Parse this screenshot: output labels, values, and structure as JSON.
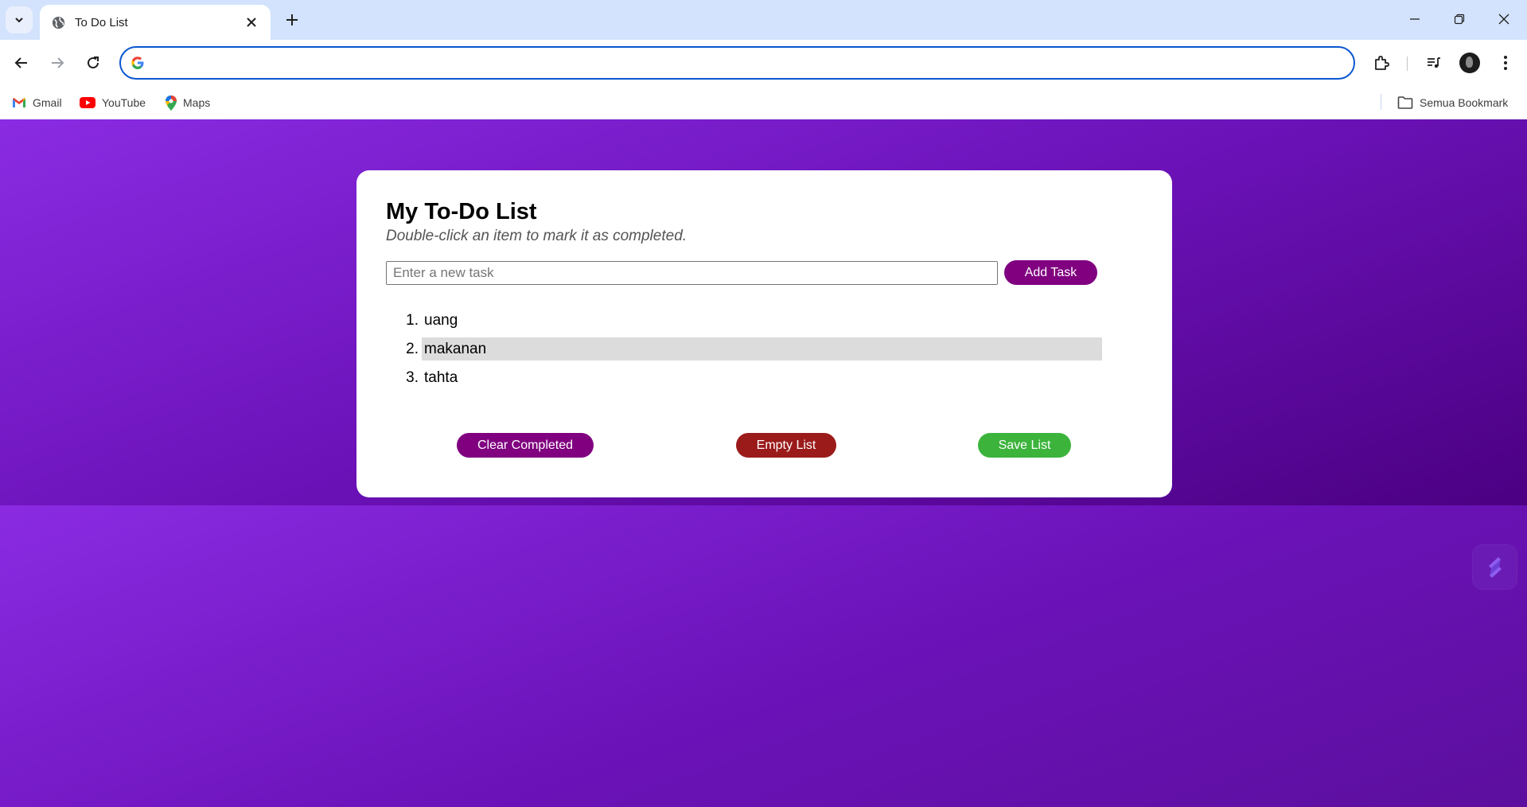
{
  "browser": {
    "tab_title": "To Do List",
    "omnibox_value": "",
    "bookmarks": [
      {
        "label": "Gmail",
        "icon": "gmail-icon"
      },
      {
        "label": "YouTube",
        "icon": "youtube-icon"
      },
      {
        "label": "Maps",
        "icon": "maps-icon"
      }
    ],
    "all_bookmarks_label": "Semua Bookmark"
  },
  "app": {
    "title": "My To-Do List",
    "subtitle": "Double-click an item to mark it as completed.",
    "input_placeholder": "Enter a new task",
    "add_button": "Add Task",
    "tasks": [
      {
        "number": "1.",
        "text": "uang"
      },
      {
        "number": "2.",
        "text": "makanan"
      },
      {
        "number": "3.",
        "text": "tahta"
      }
    ],
    "clear_completed_button": "Clear Completed",
    "empty_list_button": "Empty List",
    "save_list_button": "Save List"
  },
  "colors": {
    "accent_purple": "#800080",
    "danger_red": "#9b1b1b",
    "success_green": "#3cb43c",
    "background_purple": "#8a2be2"
  }
}
